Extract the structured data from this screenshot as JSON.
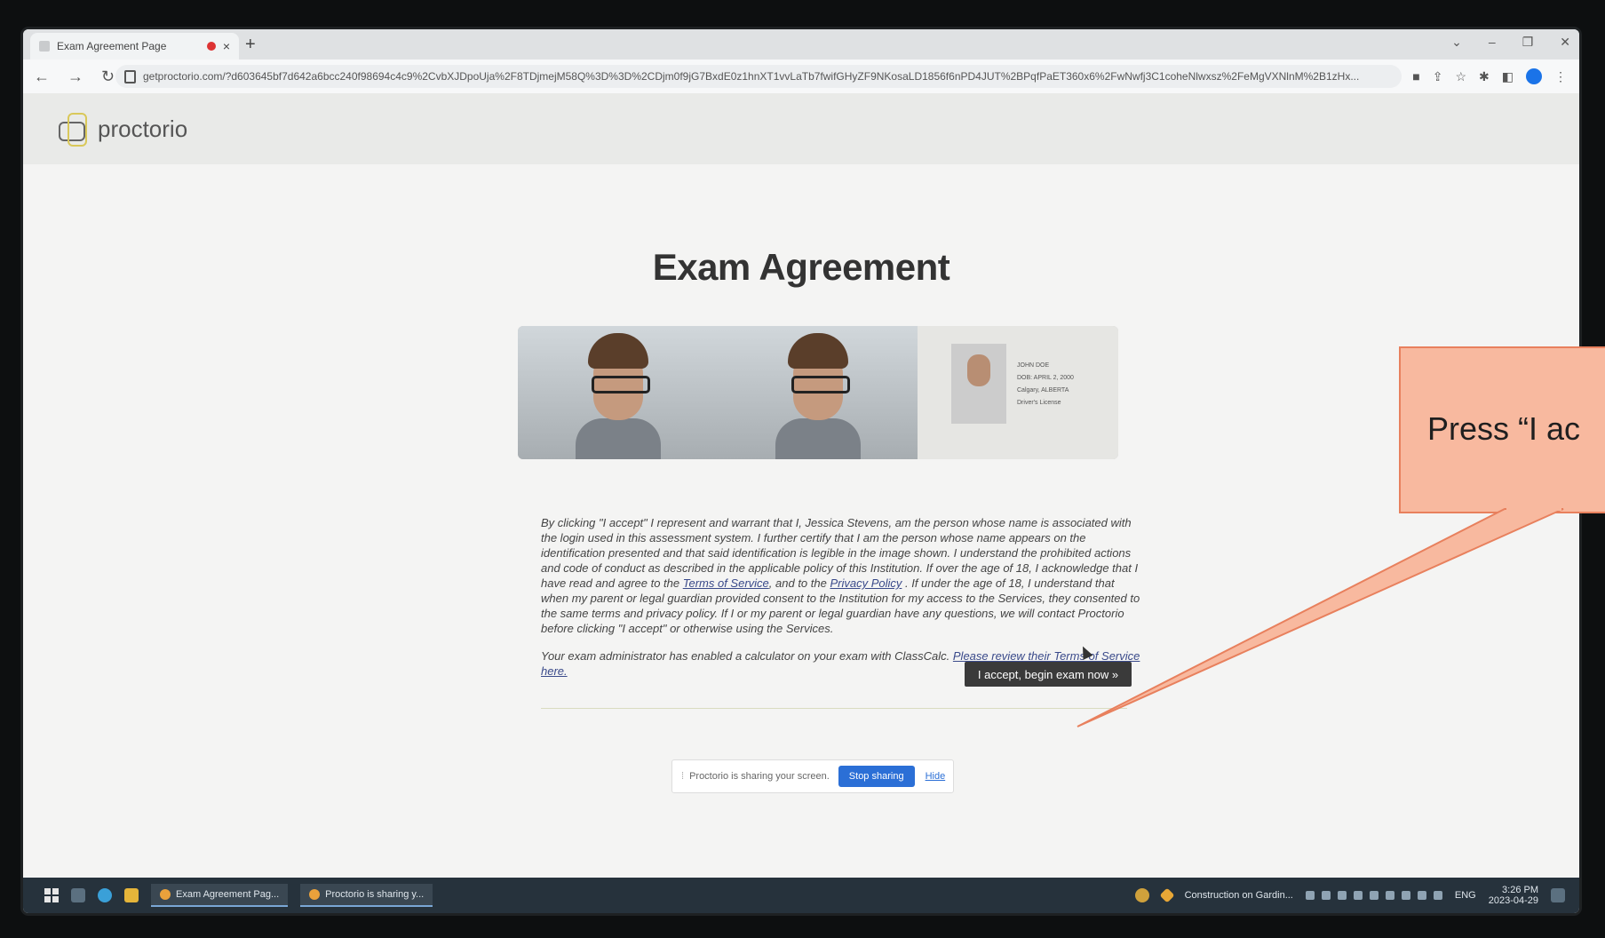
{
  "browser": {
    "tab_title": "Exam Agreement Page",
    "tab_close": "×",
    "new_tab": "+",
    "url": "getproctorio.com/?d603645bf7d642a6bcc240f98694c4c9%2CvbXJDpoUja%2F8TDjmejM58Q%3D%3D%2CDjm0f9jG7BxdE0z1hnXT1vvLaTb7fwifGHyZF9NKosaLD1856f6nPD4JUT%2BPqfPaET360x6%2FwNwfj3C1coheNlwxsz%2FeMgVXNlnM%2B1zHx...",
    "window_controls": [
      "⌄",
      "–",
      "❐",
      "✕"
    ]
  },
  "header": {
    "brand": "proctorio"
  },
  "main": {
    "title": "Exam Agreement",
    "id_card_lines": [
      "JOHN DOE",
      "DOB: APRIL 2, 2000",
      "Calgary, ALBERTA",
      "Driver's License"
    ],
    "agreement": {
      "part1": "By clicking \"I accept\" I represent and warrant that I, Jessica Stevens, am the person whose name is associated with the login used in this assessment system. I further certify that I am the person whose name appears on the identification presented and that said identification is legible in the image shown. I understand the prohibited actions and code of conduct as described in the applicable policy of this Institution. If over the age of 18, I acknowledge that I have read and agree to the ",
      "terms_link": "Terms of Service",
      "part2": ", and to the ",
      "privacy_link": "Privacy Policy",
      "part3": " . If under the age of 18, I understand that when my parent or legal guardian provided consent to the Institution for my access to the Services, they consented to the same terms and privacy policy. If I or my parent or legal guardian have any questions, we will contact Proctorio before clicking \"I accept\" or otherwise using the Services."
    },
    "calculator": {
      "text": "Your exam administrator has enabled a calculator on your exam with ClassCalc. ",
      "link": "Please review their Terms of Service here."
    },
    "accept_button": "I accept, begin exam now »"
  },
  "sharing_bar": {
    "message": "Proctorio is sharing your screen.",
    "stop": "Stop sharing",
    "hide": "Hide"
  },
  "taskbar": {
    "tasks": [
      "Exam Agreement Pag...",
      "Proctorio is sharing y..."
    ],
    "notification": "Construction on Gardin...",
    "language": "ENG",
    "time": "3:26 PM",
    "date": "2023-04-29"
  },
  "callout": {
    "text": "Press “I ac"
  },
  "colors": {
    "callout_fill": "#f8b99f",
    "callout_border": "#e8805d",
    "button_dark": "#3a3a3a",
    "stop_sharing_blue": "#2b6fd6"
  }
}
